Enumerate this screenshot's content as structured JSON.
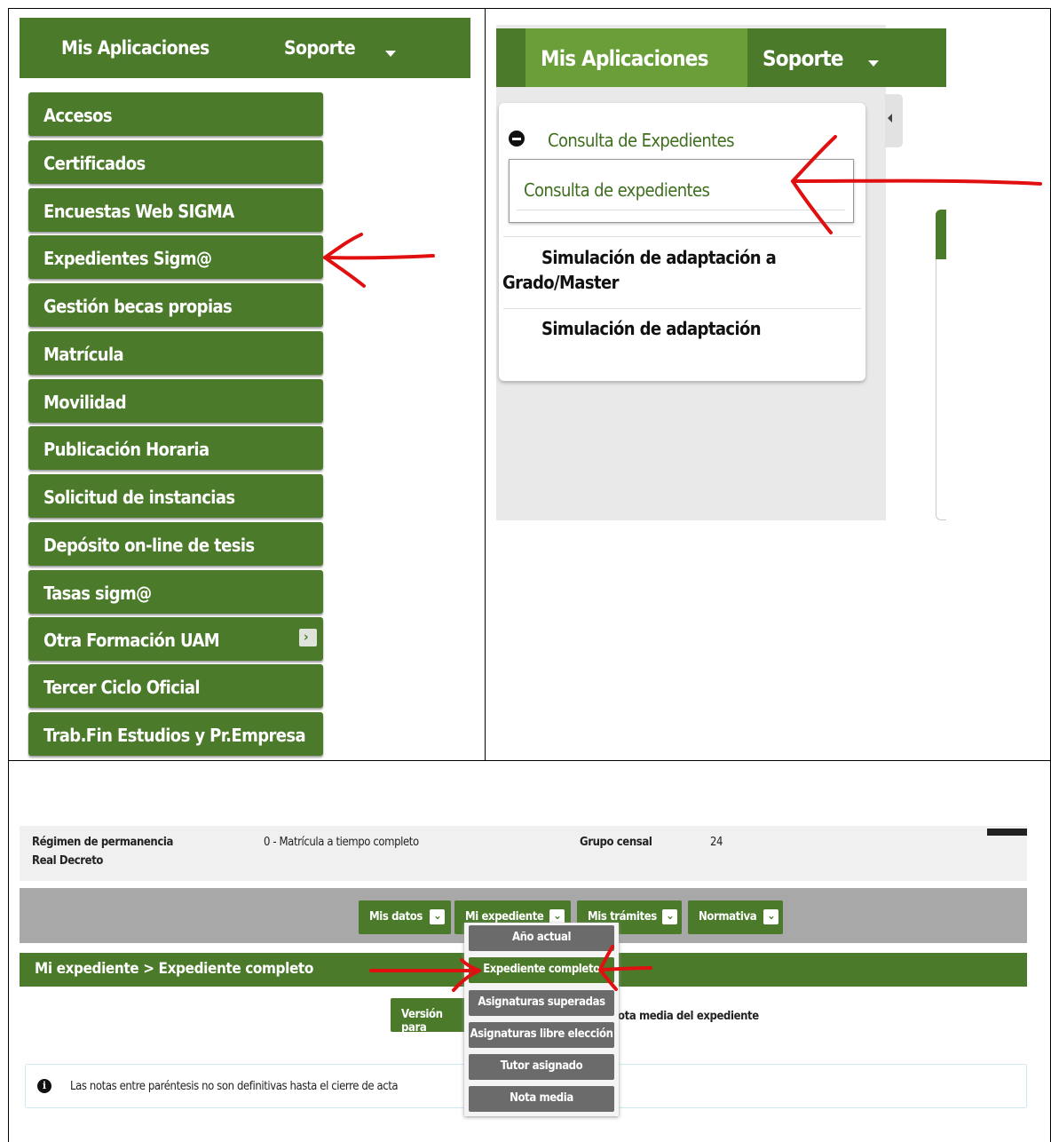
{
  "panel1": {
    "topbar": {
      "mis_aplicaciones": "Mis Aplicaciones",
      "soporte": "Soporte"
    },
    "menu": [
      {
        "label": "Accesos"
      },
      {
        "label": "Certificados"
      },
      {
        "label": "Encuestas Web SIGMA"
      },
      {
        "label": "Expedientes Sigm@"
      },
      {
        "label": "Gestión becas propias"
      },
      {
        "label": "Matrícula"
      },
      {
        "label": "Movilidad"
      },
      {
        "label": "Publicación Horaria"
      },
      {
        "label": "Solicitud de instancias"
      },
      {
        "label": "Depósito on-line de tesis"
      },
      {
        "label": "Tasas sigm@"
      },
      {
        "label": "Otra Formación UAM"
      },
      {
        "label": "Tercer Ciclo Oficial"
      },
      {
        "label": "Trab.Fin Estudios y Pr.Empresa"
      }
    ]
  },
  "panel2": {
    "topbar": {
      "mis_aplicaciones": "Mis Aplicaciones",
      "soporte": "Soporte"
    },
    "group_title": "Consulta de Expedientes",
    "selected_item": "Consulta de expedientes",
    "item_2_line1": "Simulación de adaptación a",
    "item_2_line2": "Grado/Master",
    "item_3": "Simulación de adaptación"
  },
  "panel3": {
    "info": {
      "regimen_label": "Régimen de permanencia",
      "regimen_value": "0 - Matrícula a tiempo completo",
      "grupo_label": "Grupo censal",
      "grupo_value": "24",
      "real_decreto_label": "Real Decreto"
    },
    "nav": {
      "mis_datos": "Mis datos",
      "mi_expediente": "Mi expediente",
      "mis_tramites": "Mis trámites",
      "normativa": "Normativa"
    },
    "breadcrumb": "Mi expediente > Expediente completo",
    "version_button": "Versión para",
    "nota_media_link": "ota media del expediente",
    "dropdown": [
      "Año actual",
      "Expediente completo",
      "Asignaturas superadas",
      "Asignaturas libre elección",
      "Tutor asignado",
      "Nota media"
    ],
    "notice": "Las notas entre paréntesis no son definitivas hasta el cierre de acta"
  },
  "colors": {
    "brand_green": "#4a7a2a",
    "active_green": "#6a9e39",
    "annotation_red": "#e01010",
    "dropdown_gray": "#6b6b6b"
  },
  "icons": [
    "chevron-down-icon",
    "chevron-right-icon",
    "minus-circle-icon",
    "info-icon",
    "red-arrow-annotation"
  ]
}
